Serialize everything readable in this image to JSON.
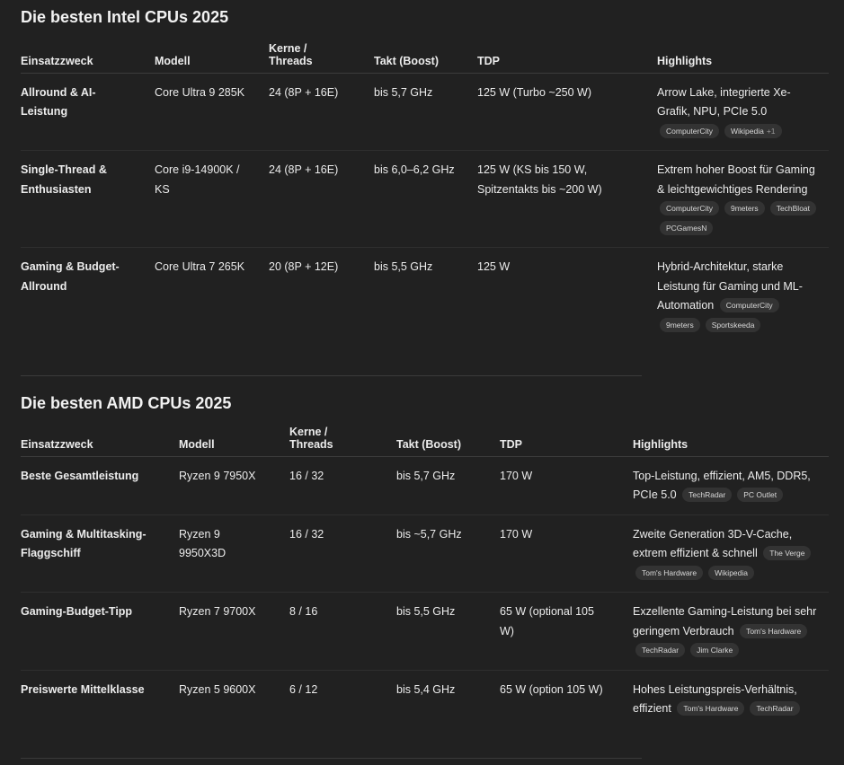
{
  "intel": {
    "title": "Die besten Intel CPUs 2025",
    "headers": [
      "Einsatzzweck",
      "Modell",
      "Kerne / Threads",
      "Takt (Boost)",
      "TDP",
      "Highlights"
    ],
    "rows": [
      {
        "use": "Allround & AI-Leistung",
        "model": "Core Ultra 9 285K",
        "cores": "24 (8P + 16E)",
        "clock": "bis 5,7 GHz",
        "tdp": "125 W (Turbo ~250 W)",
        "highlight": "Arrow Lake, integrierte Xe-Grafik, NPU, PCIe 5.0",
        "sources": [
          "ComputerCity",
          "Wikipedia"
        ],
        "extra": "+1"
      },
      {
        "use": "Single-Thread & Enthusiasten",
        "model": "Core i9-14900K / KS",
        "cores": "24 (8P + 16E)",
        "clock": "bis 6,0–6,2 GHz",
        "tdp": "125 W (KS bis 150 W, Spitzentakts bis ~200 W)",
        "highlight": "Extrem hoher Boost für Gaming & leichtgewichtiges Rendering",
        "sources": [
          "ComputerCity",
          "9meters",
          "TechBloat",
          "PCGamesN"
        ]
      },
      {
        "use": "Gaming & Budget-Allround",
        "model": "Core Ultra 7 265K",
        "cores": "20 (8P + 12E)",
        "clock": "bis 5,5 GHz",
        "tdp": "125 W",
        "highlight": "Hybrid-Architektur, starke Leistung für Gaming und ML-Automation",
        "sources": [
          "ComputerCity",
          "9meters",
          "Sportskeeda"
        ]
      }
    ]
  },
  "amd": {
    "title": "Die besten AMD CPUs 2025",
    "headers": [
      "Einsatzzweck",
      "Modell",
      "Kerne / Threads",
      "Takt (Boost)",
      "TDP",
      "Highlights"
    ],
    "rows": [
      {
        "use": "Beste Gesamtleistung",
        "model": "Ryzen 9 7950X",
        "cores": "16 / 32",
        "clock": "bis 5,7 GHz",
        "tdp": "170 W",
        "highlight": "Top-Leistung, effizient, AM5, DDR5, PCIe 5.0",
        "sources": [
          "TechRadar",
          "PC Outlet"
        ]
      },
      {
        "use": "Gaming & Multitasking-Flaggschiff",
        "model": "Ryzen 9 9950X3D",
        "cores": "16 / 32",
        "clock": "bis ~5,7 GHz",
        "tdp": "170 W",
        "highlight": "Zweite Generation 3D-V-Cache, extrem effizient & schnell",
        "sources": [
          "The Verge",
          "Tom's Hardware",
          "Wikipedia"
        ]
      },
      {
        "use": "Gaming-Budget-Tipp",
        "model": "Ryzen 7 9700X",
        "cores": "8 / 16",
        "clock": "bis 5,5 GHz",
        "tdp": "65 W (optional 105 W)",
        "highlight": "Exzellente Gaming-Leistung bei sehr geringem Verbrauch",
        "sources": [
          "Tom's Hardware",
          "TechRadar",
          "Jim Clarke"
        ]
      },
      {
        "use": "Preiswerte Mittelklasse",
        "model": "Ryzen 5 9600X",
        "cores": "6 / 12",
        "clock": "bis 5,4 GHz",
        "tdp": "65 W (option 105 W)",
        "highlight": "Hohes Leistungspreis-Verhältnis, effizient",
        "sources": [
          "Tom's Hardware",
          "TechRadar"
        ]
      }
    ]
  }
}
